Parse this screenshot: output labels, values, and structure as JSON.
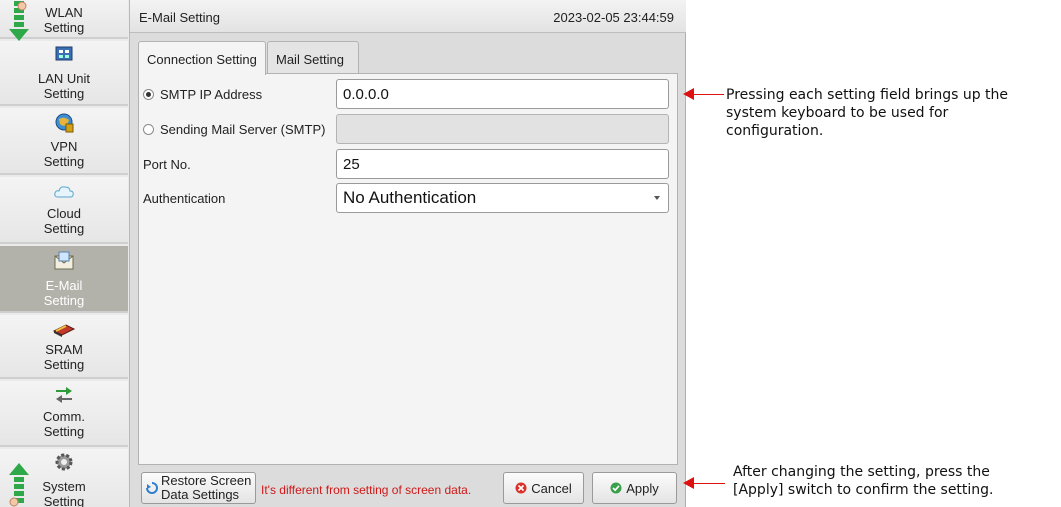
{
  "sidebar": {
    "items": [
      {
        "label": "WLAN\nSetting",
        "icon": "wlan-icon"
      },
      {
        "label": "LAN Unit\nSetting",
        "icon": "lan-unit-icon"
      },
      {
        "label": "VPN\nSetting",
        "icon": "vpn-icon"
      },
      {
        "label": "Cloud\nSetting",
        "icon": "cloud-icon"
      },
      {
        "label": "E-Mail\nSetting",
        "icon": "email-icon",
        "active": true
      },
      {
        "label": "SRAM\nSetting",
        "icon": "sram-icon"
      },
      {
        "label": "Comm.\nSetting",
        "icon": "comm-icon"
      },
      {
        "label": "System\nSetting",
        "icon": "gear-icon"
      }
    ]
  },
  "header": {
    "title": "E-Mail Setting",
    "datetime": "2023-02-05  23:44:59"
  },
  "tabs": [
    {
      "label": "Connection Setting",
      "active": true
    },
    {
      "label": "Mail Setting",
      "active": false
    }
  ],
  "form": {
    "smtp_ip": {
      "label": "SMTP IP Address",
      "value": "0.0.0.0",
      "selected": true
    },
    "smtp_server": {
      "label": "Sending Mail Server (SMTP)",
      "value": "",
      "selected": false
    },
    "port": {
      "label": "Port No.",
      "value": "25"
    },
    "auth": {
      "label": "Authentication",
      "value": "No Authentication"
    }
  },
  "footer": {
    "restore_label": "Restore Screen\nData Settings",
    "warning": "It's different from setting of screen data.",
    "cancel_label": "Cancel",
    "apply_label": "Apply"
  },
  "annotations": {
    "top": "Pressing each setting field brings up the\nsystem keyboard to be used for\nconfiguration.",
    "bottom": "After changing the setting, press the\n[Apply] switch to confirm the setting."
  },
  "colors": {
    "accent_red": "#dd1111",
    "active_item": "#b2b2ab",
    "warning_text": "#d01818"
  }
}
